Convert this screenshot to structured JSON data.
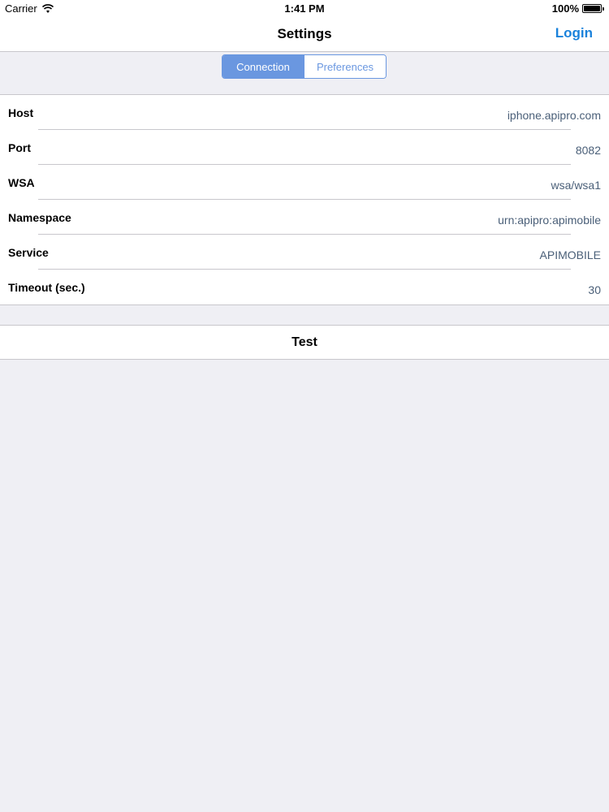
{
  "status_bar": {
    "carrier": "Carrier",
    "time": "1:41 PM",
    "battery_percent": "100%",
    "wifi_icon": "wifi-icon",
    "battery_icon": "battery-icon"
  },
  "nav": {
    "title": "Settings",
    "login_label": "Login",
    "accent_color": "#1a82db"
  },
  "segments": [
    {
      "label": "Connection",
      "selected": true
    },
    {
      "label": "Preferences",
      "selected": false
    }
  ],
  "settings": [
    {
      "label": "Host",
      "value": "iphone.apipro.com"
    },
    {
      "label": "Port",
      "value": "8082"
    },
    {
      "label": "WSA",
      "value": "wsa/wsa1"
    },
    {
      "label": "Namespace",
      "value": "urn:apipro:apimobile"
    },
    {
      "label": "Service",
      "value": "APIMOBILE"
    },
    {
      "label": "Timeout (sec.)",
      "value": "30"
    }
  ],
  "test_button": {
    "label": "Test"
  }
}
